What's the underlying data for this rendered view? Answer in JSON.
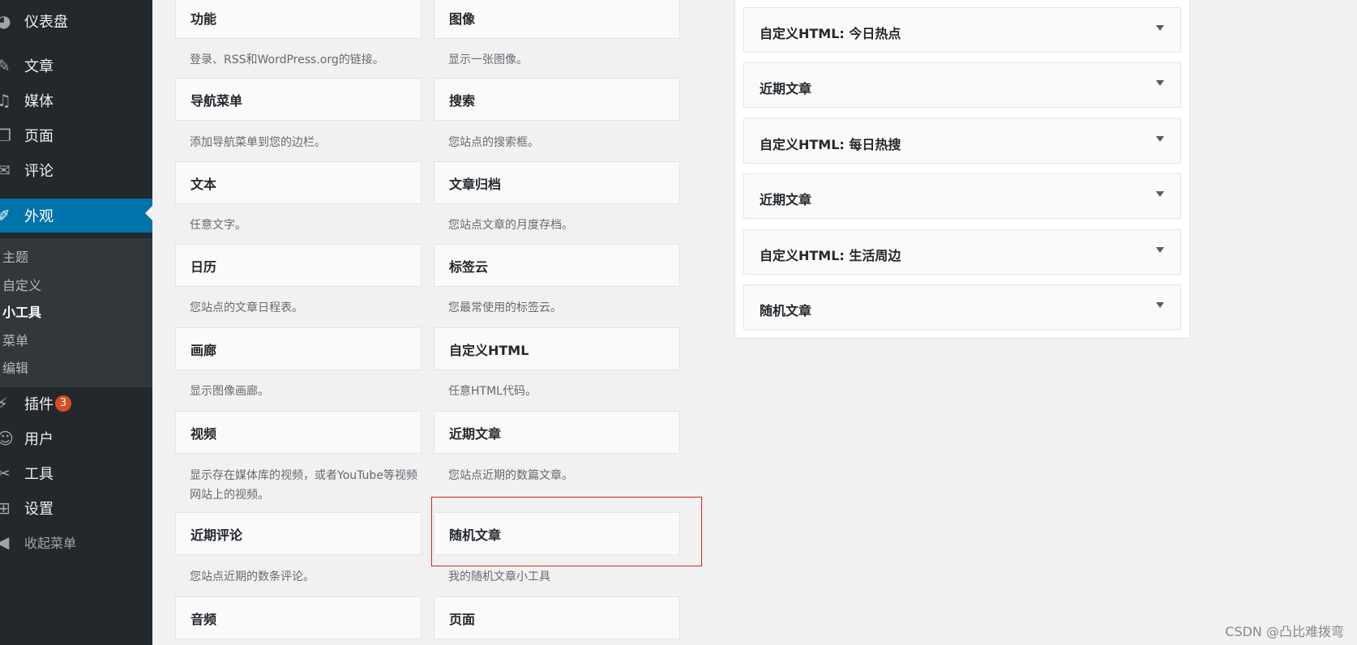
{
  "sidebar": {
    "menu": [
      {
        "icon": "dashboard-icon",
        "glyph": "◕",
        "label": "仪表盘"
      },
      {
        "icon": "pin-icon",
        "glyph": "✎",
        "label": "文章"
      },
      {
        "icon": "media-icon",
        "glyph": "♫",
        "label": "媒体"
      },
      {
        "icon": "page-icon",
        "glyph": "❐",
        "label": "页面"
      },
      {
        "icon": "comment-icon",
        "glyph": "✉",
        "label": "评论"
      },
      {
        "icon": "appearance-icon",
        "glyph": "✐",
        "label": "外观"
      },
      {
        "icon": "plugin-icon",
        "glyph": "⚡",
        "label": "插件",
        "badge": "3"
      },
      {
        "icon": "user-icon",
        "glyph": "☺",
        "label": "用户"
      },
      {
        "icon": "tools-icon",
        "glyph": "✂",
        "label": "工具"
      },
      {
        "icon": "settings-icon",
        "glyph": "⊞",
        "label": "设置"
      },
      {
        "icon": "collapse-icon",
        "glyph": "◀",
        "label": "收起菜单"
      }
    ],
    "submenu": [
      "主题",
      "自定义",
      "小工具",
      "菜单",
      "编辑"
    ]
  },
  "available_widgets": [
    {
      "title": "功能",
      "desc": "登录、RSS和WordPress.org的链接。"
    },
    {
      "title": "图像",
      "desc": "显示一张图像。"
    },
    {
      "title": "导航菜单",
      "desc": "添加导航菜单到您的边栏。"
    },
    {
      "title": "搜索",
      "desc": "您站点的搜索框。"
    },
    {
      "title": "文本",
      "desc": "任意文字。"
    },
    {
      "title": "文章归档",
      "desc": "您站点文章的月度存档。"
    },
    {
      "title": "日历",
      "desc": "您站点的文章日程表。"
    },
    {
      "title": "标签云",
      "desc": "您最常使用的标签云。"
    },
    {
      "title": "画廊",
      "desc": "显示图像画廊。"
    },
    {
      "title": "自定义HTML",
      "desc": "任意HTML代码。"
    },
    {
      "title": "视频",
      "desc": "显示存在媒体库的视频，或者YouTube等视频网站上的视频。"
    },
    {
      "title": "近期文章",
      "desc": "您站点近期的数篇文章。"
    },
    {
      "title": "近期评论",
      "desc": "您站点近期的数条评论。"
    },
    {
      "title": "随机文章",
      "desc": "我的随机文章小工具"
    },
    {
      "title": "音频",
      "desc": ""
    },
    {
      "title": "页面",
      "desc": ""
    }
  ],
  "sidebar_area_widgets": [
    "自定义HTML: 今日热点",
    "近期文章",
    "自定义HTML: 每日热搜",
    "近期文章",
    "自定义HTML: 生活周边",
    "随机文章"
  ],
  "watermark": "CSDN @凸比难拨弯",
  "colors": {
    "sidebar_bg": "#23282d",
    "active_bg": "#0073aa",
    "badge": "#d54e21",
    "highlight": "#e02020"
  }
}
